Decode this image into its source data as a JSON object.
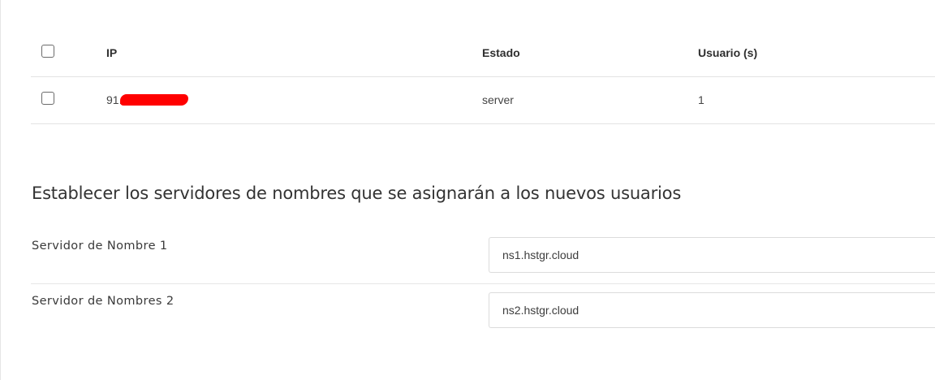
{
  "ip_table": {
    "columns": {
      "ip": "IP",
      "estado": "Estado",
      "usuarios": "Usuario (s)"
    },
    "rows": [
      {
        "ip_prefix": "91.",
        "estado": "server",
        "usuarios": "1"
      }
    ]
  },
  "nameservers": {
    "title": "Establecer los servidores de nombres que se asignarán a los nuevos usuarios",
    "ns1": {
      "label": "Servidor de Nombre 1",
      "value": "ns1.hstgr.cloud"
    },
    "ns2": {
      "label": "Servidor de Nombres 2",
      "value": "ns2.hstgr.cloud"
    }
  },
  "colors": {
    "redaction": "#ff0000",
    "border": "#e3e3e3"
  }
}
